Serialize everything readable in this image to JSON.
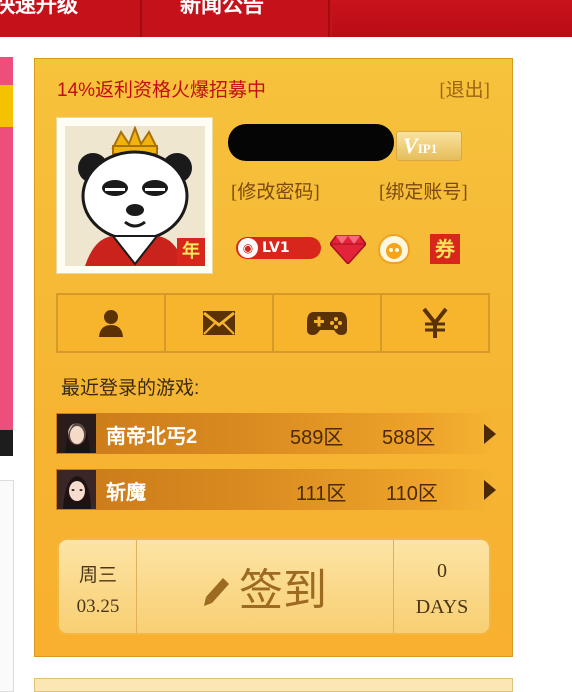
{
  "nav": {
    "tabs": [
      {
        "label": "快速升级"
      },
      {
        "label": "新闻公告"
      }
    ]
  },
  "panel": {
    "promo_text": "14%返利资格火爆招募中",
    "logout_label": "[退出]",
    "avatar": {
      "badge": "年"
    },
    "vip": {
      "prefix": "V",
      "level_text": "IP1"
    },
    "links": {
      "change_password": "[修改密码]",
      "bind_account": "[绑定账号]"
    },
    "level_badge": "LV1",
    "coupon_badge": "券",
    "icon_buttons": [
      {
        "icon": "user-icon"
      },
      {
        "icon": "mail-icon"
      },
      {
        "icon": "gamepad-icon"
      },
      {
        "icon": "yen-icon"
      }
    ],
    "recent_label": "最近登录的游戏:",
    "recent_games": [
      {
        "name": "南帝北丐2",
        "zone_a": "589区",
        "zone_b": "588区"
      },
      {
        "name": "斩魔",
        "zone_a": "111区",
        "zone_b": "110区"
      }
    ],
    "signin": {
      "weekday": "周三",
      "date": "03.25",
      "button_label": "签到",
      "days_count": "0",
      "days_unit": "DAYS"
    }
  },
  "colors": {
    "nav_red": "#c4111a",
    "panel_orange": "#f5b532",
    "promo_red": "#c20d12"
  }
}
